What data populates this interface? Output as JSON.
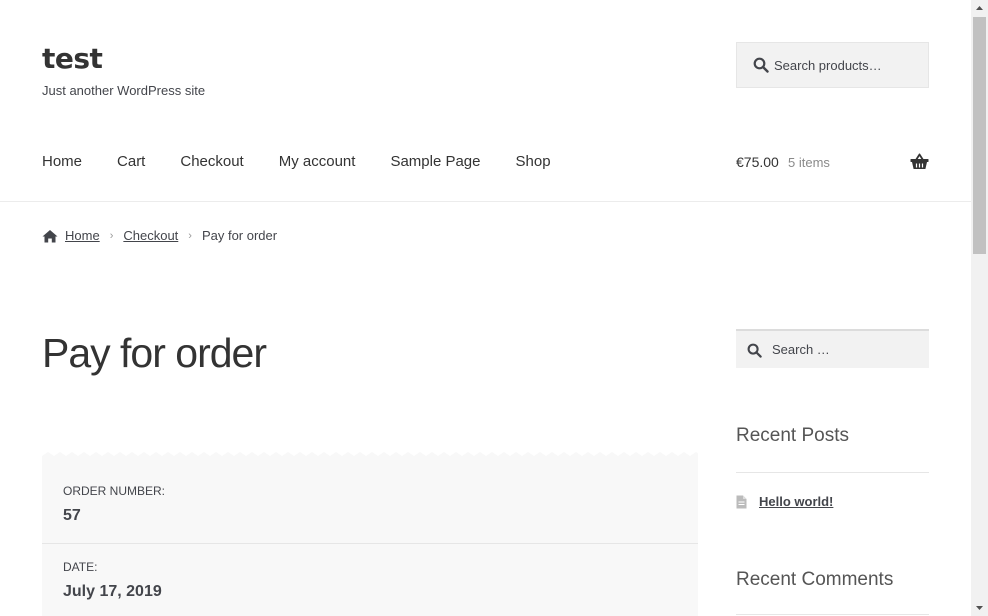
{
  "header": {
    "site_title": "test",
    "site_description": "Just another WordPress site",
    "search_placeholder": "Search products…"
  },
  "nav": {
    "items": [
      "Home",
      "Cart",
      "Checkout",
      "My account",
      "Sample Page",
      "Shop"
    ]
  },
  "cart": {
    "amount": "€75.00",
    "count": "5 items"
  },
  "breadcrumb": {
    "home": "Home",
    "checkout": "Checkout",
    "current": "Pay for order"
  },
  "main": {
    "page_title": "Pay for order",
    "order_number_label": "ORDER NUMBER:",
    "order_number_value": "57",
    "date_label": "DATE:",
    "date_value": "July 17, 2019"
  },
  "sidebar": {
    "search_placeholder": "Search …",
    "recent_posts_title": "Recent Posts",
    "recent_post_1": "Hello world!",
    "recent_comments_title": "Recent Comments"
  },
  "icons": {
    "search": "search-icon",
    "cart": "basket-icon",
    "home": "home-icon",
    "document": "document-icon"
  },
  "colors": {
    "text": "#43454b",
    "heading": "#333333",
    "card_bg": "#f8f8f8",
    "search_bg": "#f2f2f2"
  }
}
